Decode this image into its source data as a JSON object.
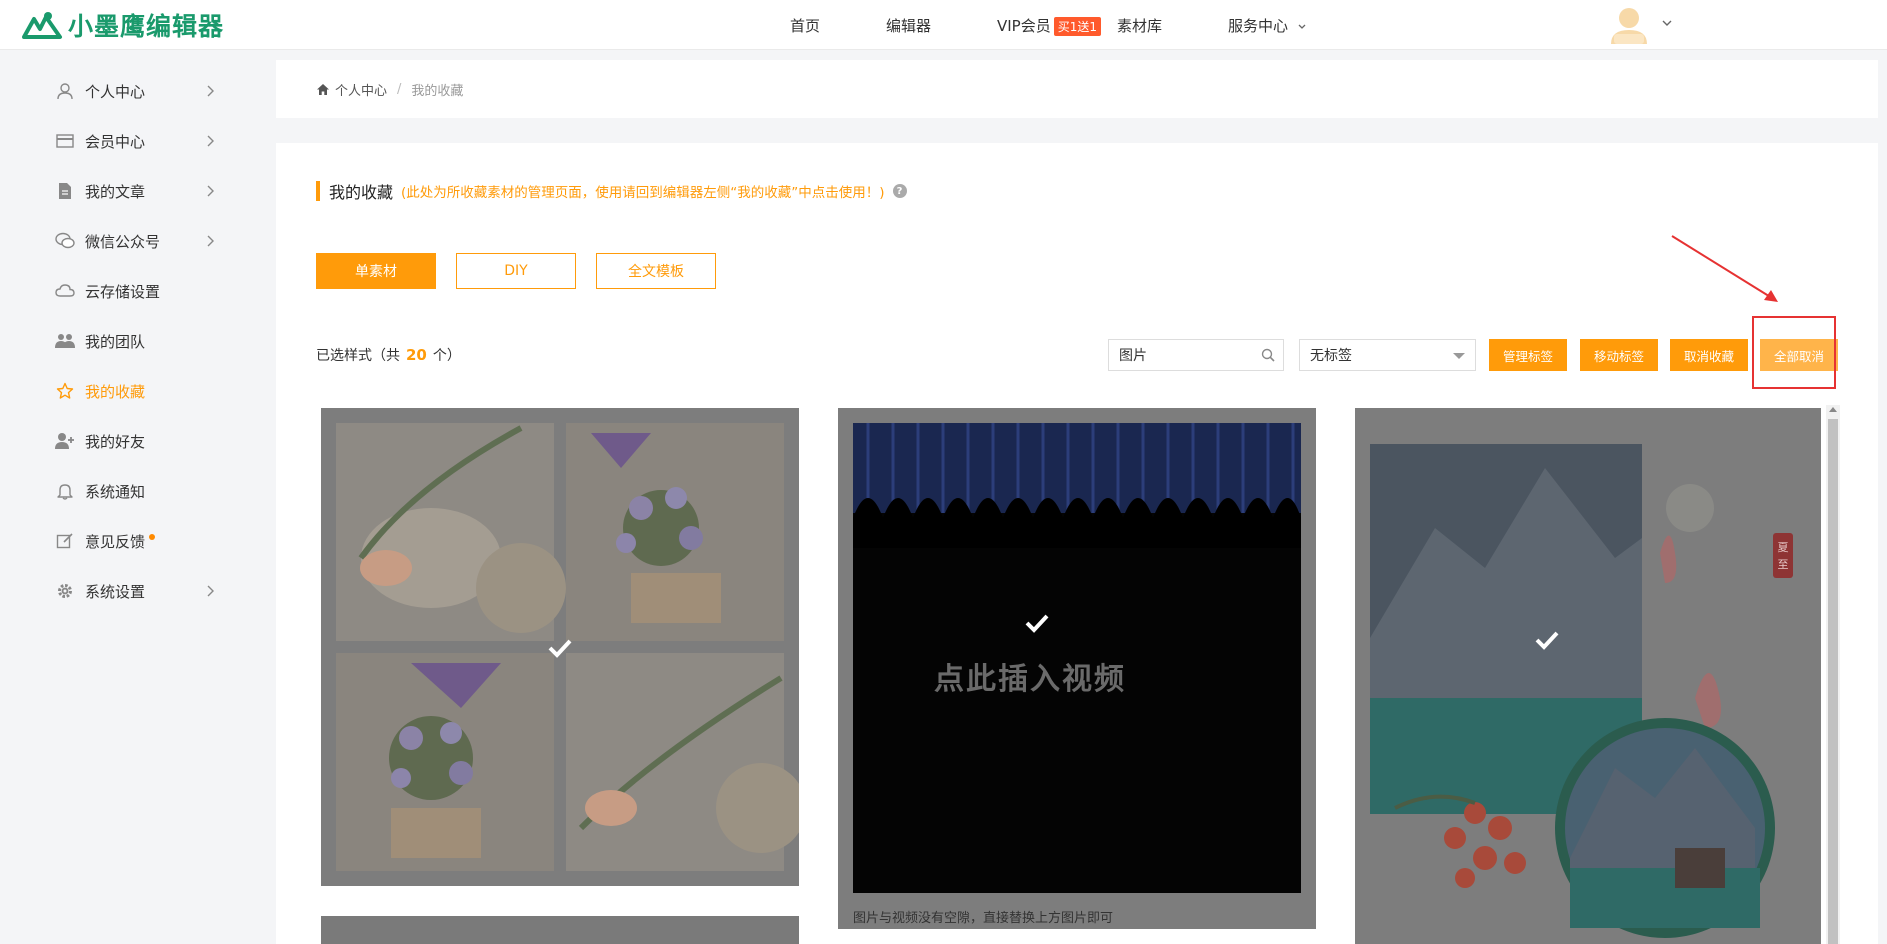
{
  "brand": {
    "name": "小墨鹰编辑器",
    "color": "#1a9a6c"
  },
  "accent_color": "#ff9b0a",
  "nav": {
    "home": "首页",
    "editor": "编辑器",
    "vip": "VIP会员",
    "vip_badge": "买1送1",
    "materials": "素材库",
    "service": "服务中心"
  },
  "sidebar": {
    "items": [
      {
        "label": "个人中心",
        "icon": "user-icon",
        "chevron": true
      },
      {
        "label": "会员中心",
        "icon": "card-icon",
        "chevron": true
      },
      {
        "label": "我的文章",
        "icon": "document-icon",
        "chevron": true
      },
      {
        "label": "微信公众号",
        "icon": "chat-icon",
        "chevron": true
      },
      {
        "label": "云存储设置",
        "icon": "cloud-icon",
        "chevron": false
      },
      {
        "label": "我的团队",
        "icon": "team-icon",
        "chevron": false
      },
      {
        "label": "我的收藏",
        "icon": "star-icon",
        "chevron": false,
        "active": true
      },
      {
        "label": "我的好友",
        "icon": "add-friend-icon",
        "chevron": false
      },
      {
        "label": "系统通知",
        "icon": "bell-icon",
        "chevron": false
      },
      {
        "label": "意见反馈",
        "icon": "edit-icon",
        "chevron": false,
        "dot": true
      },
      {
        "label": "系统设置",
        "icon": "gear-icon",
        "chevron": true
      }
    ]
  },
  "breadcrumb": {
    "root": "个人中心",
    "separator": "/",
    "current": "我的收藏"
  },
  "section": {
    "title": "我的收藏",
    "hint": "(此处为所收藏素材的管理页面，使用请回到编辑器左侧“我的收藏”中点击使用！)",
    "help": "?"
  },
  "tabs": [
    {
      "label": "单素材",
      "active": true
    },
    {
      "label": "DIY",
      "active": false
    },
    {
      "label": "全文模板",
      "active": false
    }
  ],
  "selection": {
    "prefix": "已选样式（共",
    "count": "20",
    "suffix": "个）"
  },
  "filters": {
    "search_value": "图片",
    "tag_select": "无标签"
  },
  "actions": {
    "manage_tags": "管理标签",
    "move_tags": "移动标签",
    "cancel_fav": "取消收藏",
    "cancel_all": "全部取消"
  },
  "items": [
    {
      "type": "image-grid",
      "selected": true
    },
    {
      "type": "video",
      "selected": true,
      "video_text": "点此插入视频",
      "caption": "图片与视频没有空隙，直接替换上方图片即可"
    },
    {
      "type": "landscape",
      "selected": true,
      "stamp": "夏至"
    }
  ]
}
